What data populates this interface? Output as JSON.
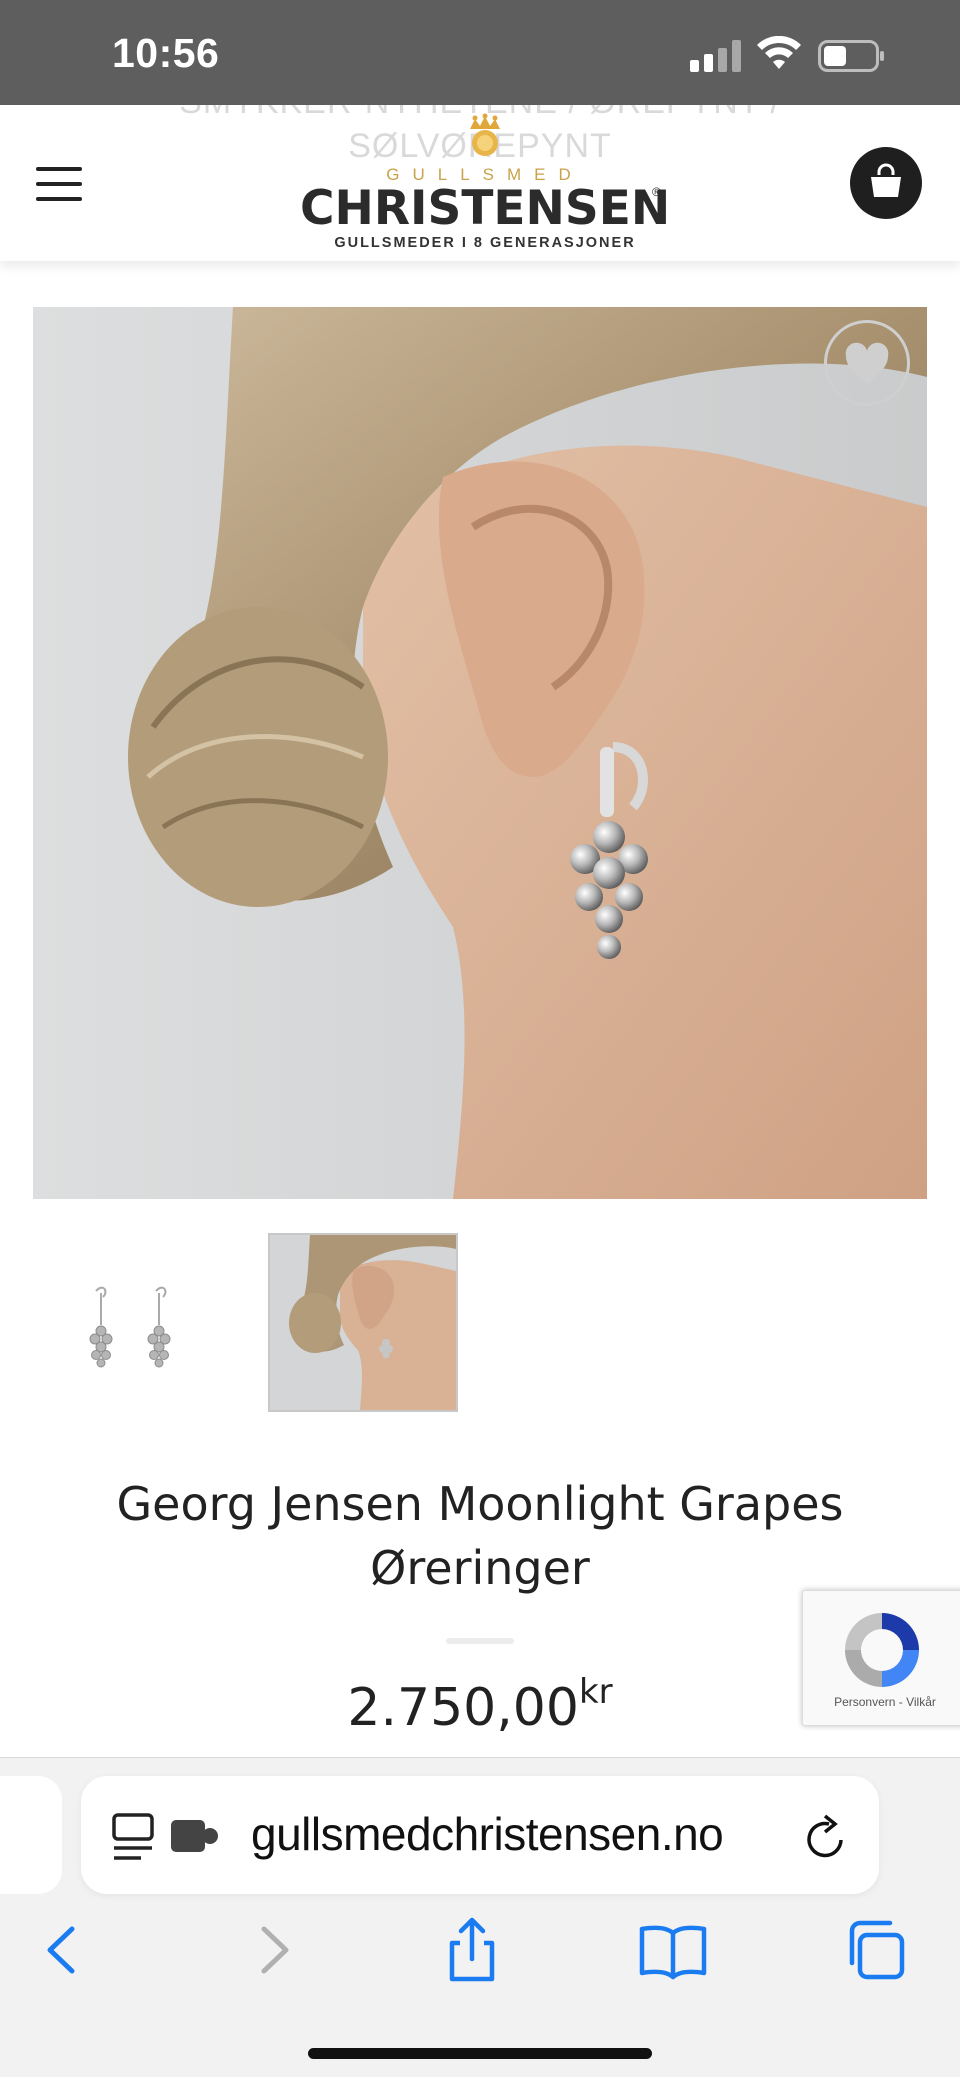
{
  "status_bar": {
    "time": "10:56"
  },
  "header": {
    "breadcrumb": {
      "line1": "SMYKKER-NYHETENE / ØREPYNT /",
      "line2": "SØLVØREPYNT"
    },
    "logo": {
      "gullsmed": "GULLSMED",
      "name": "CHRISTENSEN",
      "registered": "®",
      "tagline": "GULLSMEDER I 8 GENERASJONER"
    },
    "menu_icon": "hamburger-icon",
    "cart_icon": "shopping-bag-icon"
  },
  "product": {
    "image_alt": "Woman wearing silver grape earring",
    "wishlist_icon": "heart-icon",
    "title_line1": "Georg Jensen Moonlight Grapes",
    "title_line2": "Øreringer",
    "price": "2.750,00",
    "currency": "kr"
  },
  "recaptcha": {
    "text": "Personvern - Vilkår"
  },
  "browser": {
    "url": "gullsmedchristensen.no",
    "icons": [
      "reader-icon",
      "extension-icon",
      "reload-icon",
      "back-icon",
      "forward-icon",
      "share-icon",
      "bookmarks-icon",
      "tabs-icon"
    ]
  },
  "colors": {
    "status_bar": "#5e5e5e",
    "logo_gold": "#c9a24a",
    "logo_dark": "#2b2b2b",
    "ios_blue": "#1a7cf0"
  }
}
